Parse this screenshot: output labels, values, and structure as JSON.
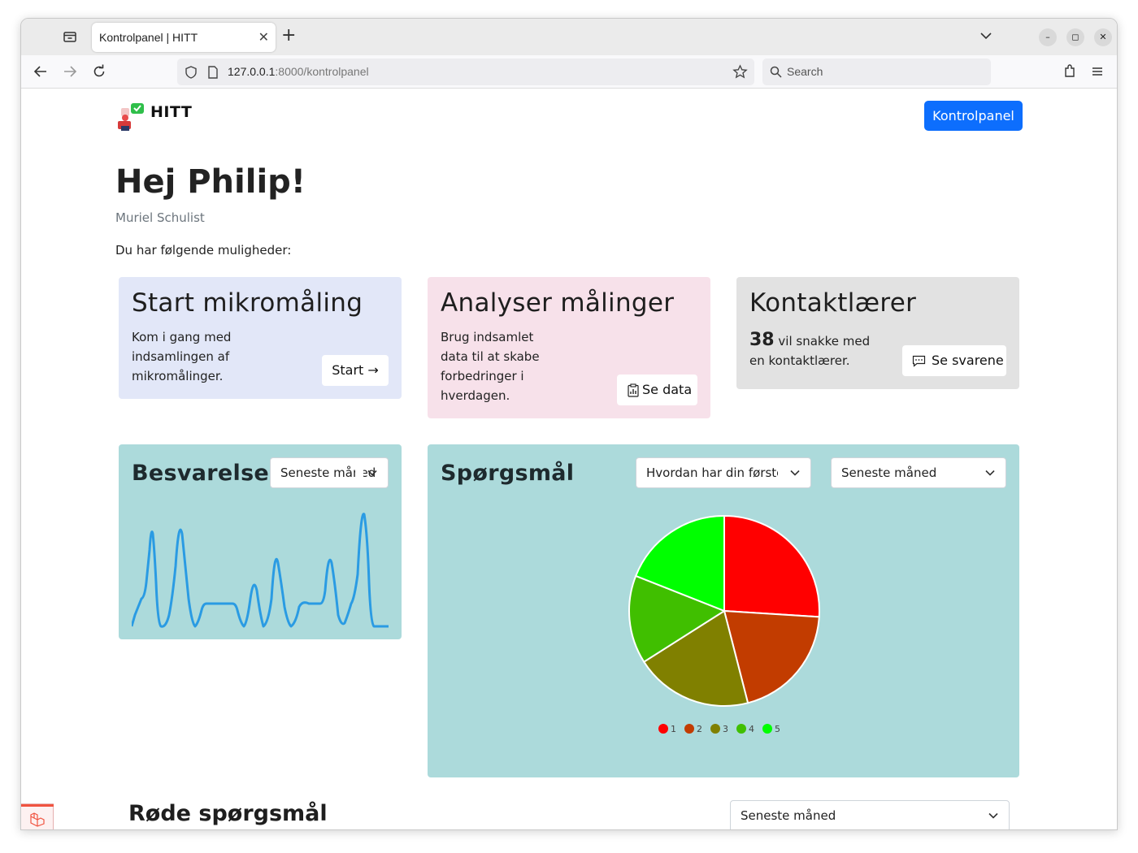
{
  "browser": {
    "tab_title": "Kontrolpanel | HITT",
    "url_host": "127.0.0.1",
    "url_path": ":8000/kontrolpanel",
    "search_placeholder": "Search"
  },
  "header": {
    "brand": "HITT",
    "dashboard_button": "Kontrolpanel"
  },
  "greeting": {
    "title": "Hej Philip!",
    "subtitle": "Muriel Schulist",
    "intro": "Du har følgende muligheder:"
  },
  "cards": [
    {
      "title": "Start mikromåling",
      "lines": [
        "Kom i gang med",
        "indsamlingen af",
        "mikromålinger."
      ],
      "button": "Start →",
      "color": "#e2e7f8"
    },
    {
      "title": "Analyser målinger",
      "lines": [
        "Brug indsamlet",
        "data til at skabe",
        "forbedringer i",
        "hverdagen."
      ],
      "button": "Se data",
      "color": "#f7e1ea"
    },
    {
      "title": "Kontaktlærer",
      "count": "38",
      "count_text": "vil snakke med",
      "line2": "en kontaktlærer.",
      "button": "Se svarene",
      "color": "#e2e2e2"
    }
  ],
  "besvarelser": {
    "title": "Besvarelser",
    "period": "Seneste måned",
    "line_color": "#2a9be3"
  },
  "spoergsmaal": {
    "title": "Spørgsmål",
    "question": "Hvordan har din første",
    "period": "Seneste måned"
  },
  "chart_data": {
    "type": "pie",
    "categories": [
      "1",
      "2",
      "3",
      "4",
      "5"
    ],
    "values": [
      26,
      20,
      20,
      15,
      19
    ],
    "colors": [
      "#ff0000",
      "#c23c00",
      "#808000",
      "#40bf00",
      "#00ff00"
    ]
  },
  "rode": {
    "title": "Røde spørgsmål",
    "period": "Seneste måned"
  }
}
